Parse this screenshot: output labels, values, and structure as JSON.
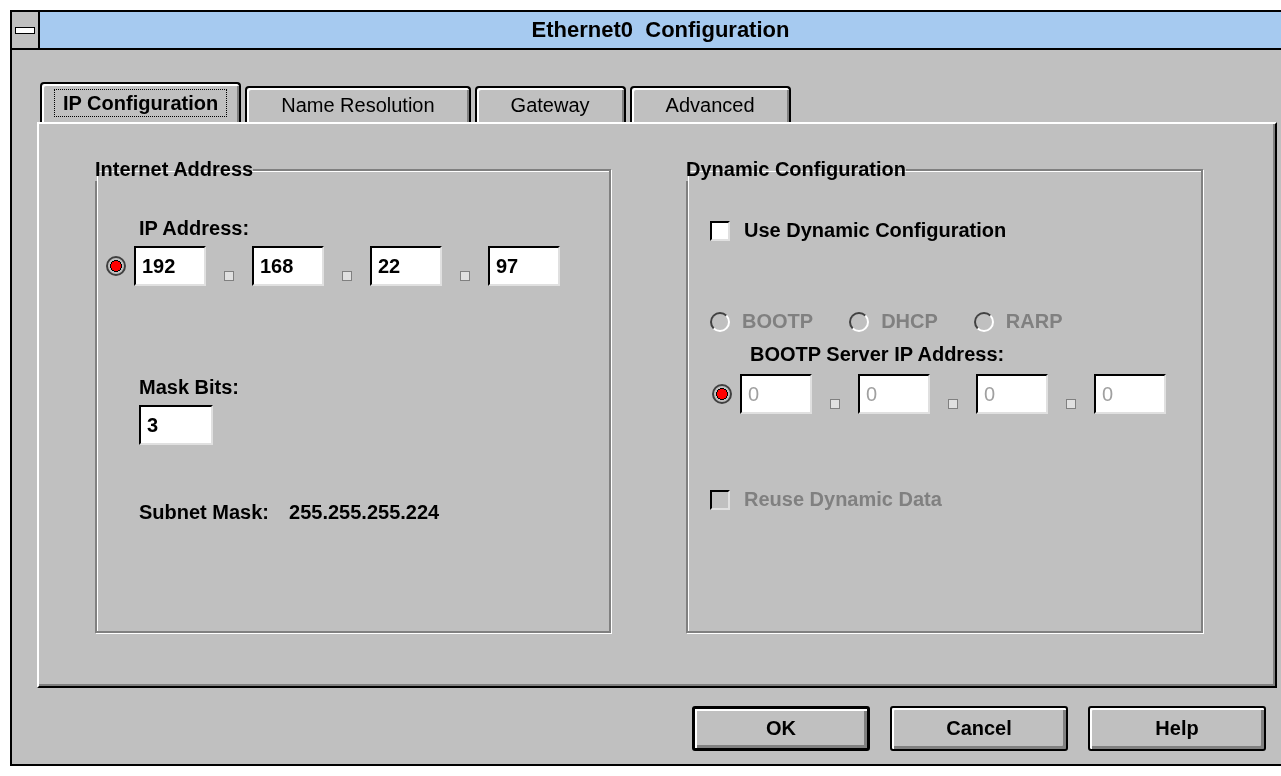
{
  "window": {
    "title": "Ethernet0  Configuration"
  },
  "tabs": [
    {
      "label": "IP Configuration",
      "selected": true
    },
    {
      "label": "Name Resolution",
      "selected": false
    },
    {
      "label": "Gateway",
      "selected": false
    },
    {
      "label": "Advanced",
      "selected": false
    }
  ],
  "internet_address": {
    "title": "Internet Address",
    "ip_label": "IP Address:",
    "ip_indicator": {
      "selected": true
    },
    "ip_octets": [
      {
        "value": "192",
        "disabled": false
      },
      {
        "value": "168",
        "disabled": false
      },
      {
        "value": "22",
        "disabled": false
      },
      {
        "value": "97",
        "disabled": false
      }
    ],
    "mask_label": "Mask Bits:",
    "mask_bits": "3",
    "subnet_label": "Subnet Mask:",
    "subnet_value": "255.255.255.224"
  },
  "dynamic": {
    "title": "Dynamic Configuration",
    "use_dynamic": {
      "label": "Use Dynamic Configuration",
      "checked": false,
      "disabled": false
    },
    "protocols": [
      {
        "label": "BOOTP",
        "selected": false,
        "disabled": true
      },
      {
        "label": "DHCP",
        "selected": false,
        "disabled": true
      },
      {
        "label": "RARP",
        "selected": false,
        "disabled": true
      }
    ],
    "server_label": "BOOTP Server IP Address:",
    "server_indicator": {
      "selected": true
    },
    "server_octets": [
      {
        "value": "0",
        "disabled": true
      },
      {
        "value": "0",
        "disabled": true
      },
      {
        "value": "0",
        "disabled": true
      },
      {
        "value": "0",
        "disabled": true
      }
    ],
    "reuse": {
      "label": "Reuse Dynamic Data",
      "checked": false,
      "disabled": true
    }
  },
  "buttons": [
    {
      "label": "OK",
      "default": true
    },
    {
      "label": "Cancel",
      "default": false
    },
    {
      "label": "Help",
      "default": false
    }
  ]
}
